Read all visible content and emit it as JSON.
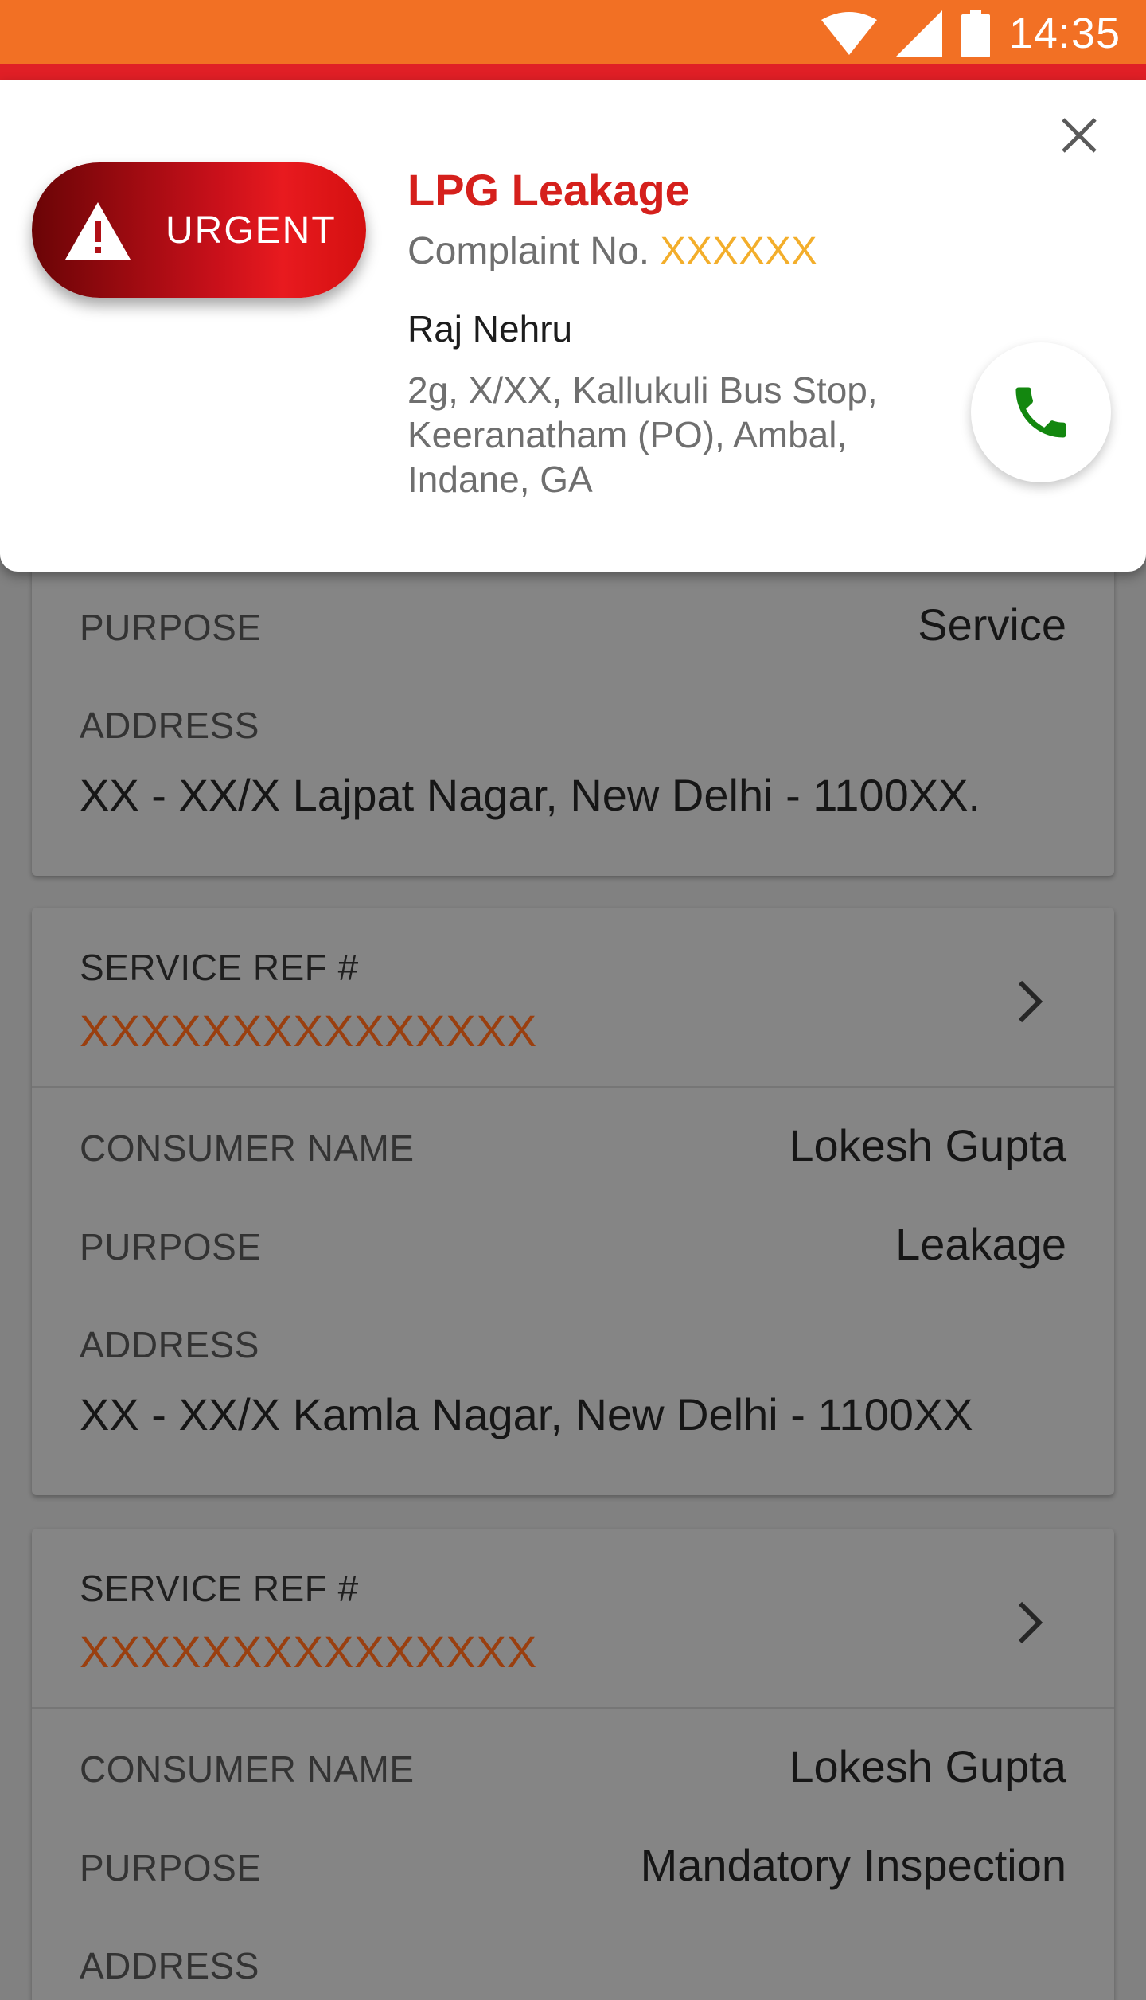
{
  "status_bar": {
    "time": "14:35"
  },
  "popup": {
    "badge_label": "URGENT",
    "title": "LPG Leakage",
    "complaint_prefix": "Complaint No.",
    "complaint_number": "XXXXXX",
    "person_name": "Raj Nehru",
    "address_lines": [
      "2g, X/XX, Kallukuli Bus Stop,",
      "Keeranatham (PO), Ambal,",
      "Indane, GA"
    ]
  },
  "cards": [
    {
      "purpose_label": "PURPOSE",
      "purpose": "Service",
      "address_label": "ADDRESS",
      "address": "XX - XX/X Lajpat Nagar, New Delhi - 1100XX."
    },
    {
      "ref_label": "SERVICE REF  #",
      "ref_value": "XXXXXXXXXXXXXXX",
      "consumer_label": "CONSUMER NAME",
      "consumer_name": "Lokesh Gupta",
      "purpose_label": "PURPOSE",
      "purpose": "Leakage",
      "address_label": "ADDRESS",
      "address": "XX - XX/X Kamla Nagar, New Delhi - 1100XX"
    },
    {
      "ref_label": "SERVICE REF  #",
      "ref_value": "XXXXXXXXXXXXXXX",
      "consumer_label": "CONSUMER NAME",
      "consumer_name": "Lokesh Gupta",
      "purpose_label": "PURPOSE",
      "purpose": "Mandatory Inspection",
      "address_label": "ADDRESS"
    }
  ],
  "icons": {
    "wifi": "wifi-icon",
    "signal": "signal-icon",
    "battery": "battery-icon",
    "warning": "warning-icon",
    "close": "close-icon",
    "phone": "phone-icon",
    "chevron": "chevron-right-icon"
  },
  "colors": {
    "status_bar": "#f27024",
    "accent_red": "#d5201c",
    "complaint_number": "#f3ae2b",
    "phone_green": "#13870f",
    "ref_value": "#9a3f0f"
  }
}
